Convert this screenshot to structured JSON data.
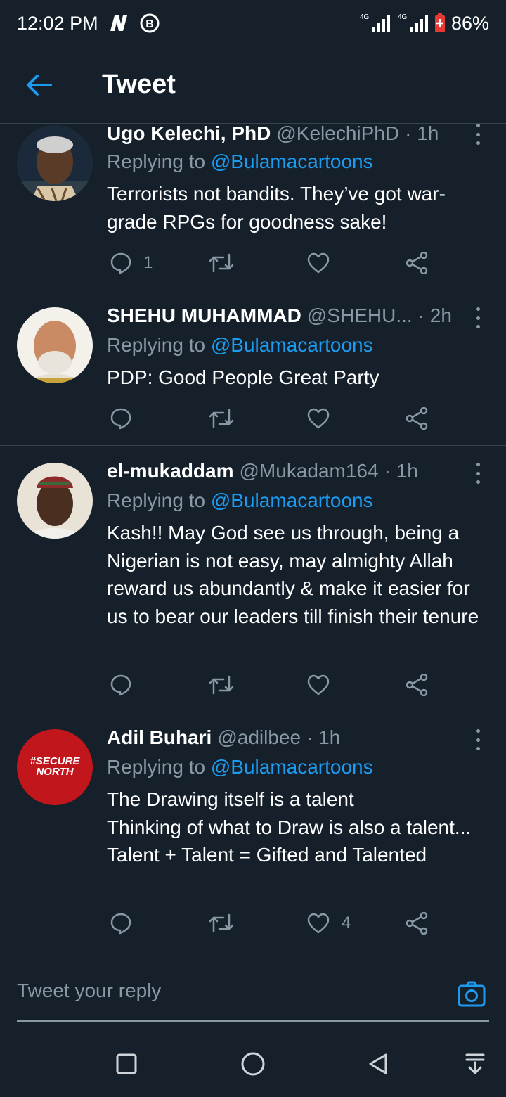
{
  "status": {
    "time": "12:02 PM",
    "net1": "4G",
    "net2": "4G",
    "battery": "86%"
  },
  "header": {
    "title": "Tweet"
  },
  "tweets": [
    {
      "name": "Ugo Kelechi, PhD",
      "handle": "@KelechiPhD",
      "time": "· 1h",
      "reply_prefix": "Replying to ",
      "reply_handle": "@Bulamacartoons",
      "text": "Terrorists not bandits. They’ve got war-grade RPGs for goodness sake!",
      "reply_count": "1",
      "retweet_count": "",
      "like_count": ""
    },
    {
      "name": "SHEHU MUHAMMAD",
      "handle": "@SHEHU...",
      "time": "· 2h",
      "reply_prefix": "Replying to ",
      "reply_handle": "@Bulamacartoons",
      "text": "PDP: Good People Great Party",
      "reply_count": "",
      "retweet_count": "",
      "like_count": ""
    },
    {
      "name": "el-mukaddam",
      "handle": "@Mukadam164",
      "time": "· 1h",
      "reply_prefix": "Replying to ",
      "reply_handle": "@Bulamacartoons",
      "text": "Kash!! May God see us through, being a Nigerian is not easy, may almighty Allah reward us abundantly & make it easier for us to bear our leaders till finish their tenure",
      "reply_count": "",
      "retweet_count": "",
      "like_count": ""
    },
    {
      "name": "Adil Buhari",
      "handle": "@adilbee",
      "time": "· 1h",
      "reply_prefix": "Replying to ",
      "reply_handle": "@Bulamacartoons",
      "text": "The Drawing itself is a talent\nThinking of what to Draw is also a talent...\nTalent + Talent = Gifted and Talented",
      "reply_count": "",
      "retweet_count": "",
      "like_count": "4",
      "avatar_text_1": "#SECURE",
      "avatar_text_2": "NORTH"
    }
  ],
  "composer": {
    "placeholder": "Tweet your reply"
  },
  "colors": {
    "background": "#15202b",
    "accent": "#1d9bf0",
    "muted": "#8899a6",
    "divider": "#38444d"
  }
}
